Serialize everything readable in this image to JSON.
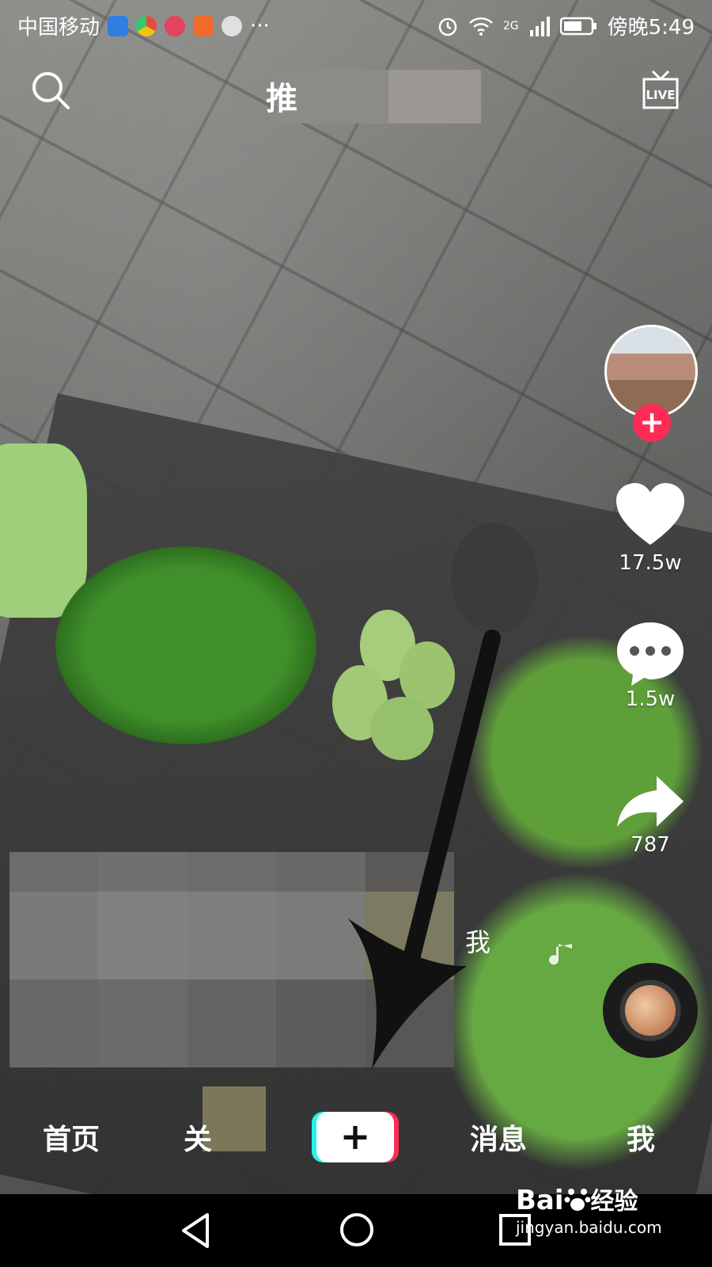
{
  "status_bar": {
    "carrier": "中国移动",
    "more": "···",
    "network": "2G",
    "time": "傍晚5:49"
  },
  "top": {
    "title_partial": "推"
  },
  "actions": {
    "likes": "17.5w",
    "comments": "1.5w",
    "shares": "787",
    "follow_symbol": "+"
  },
  "caption": {
    "me_label": "我"
  },
  "tabbar": {
    "home": "首页",
    "follow_partial": "关",
    "plus": "+",
    "messages": "消息",
    "me": "我"
  },
  "watermark": {
    "brand": "Bai",
    "brand2": "经验",
    "url": "jingyan.baidu.com"
  },
  "colors": {
    "accent": "#fe2c55",
    "cyan": "#25f4ee"
  }
}
